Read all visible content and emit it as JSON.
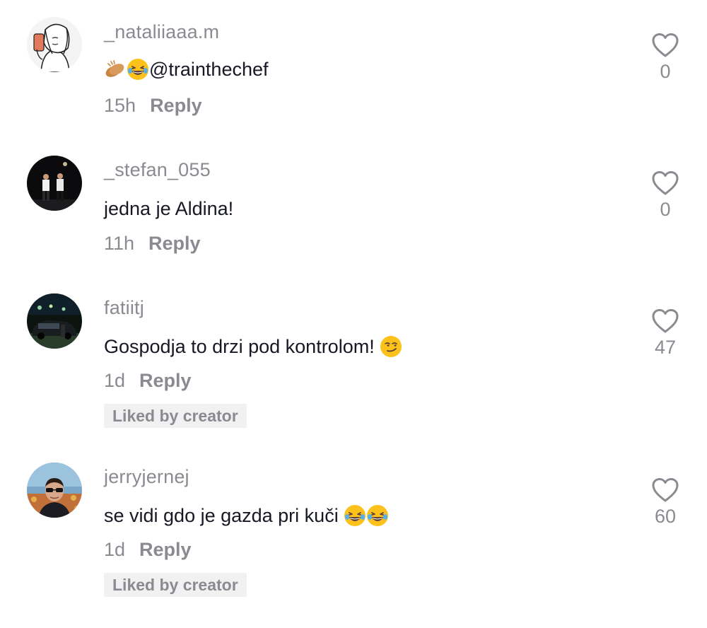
{
  "comments": [
    {
      "username": "_nataliiaaa.m",
      "text": "@trainthechef",
      "emojis": [
        "clapping-hands-emoji",
        "laughing-emoji"
      ],
      "time": "15h",
      "reply_label": "Reply",
      "likes": "0",
      "liked_by_creator": false
    },
    {
      "username": "_stefan_055",
      "text": "jedna je Aldina!",
      "emojis": [],
      "time": "11h",
      "reply_label": "Reply",
      "likes": "0",
      "liked_by_creator": false
    },
    {
      "username": "fatiitj",
      "text": "Gospodja to drzi pod kontrolom! ",
      "emojis": [
        "smirking-face-emoji"
      ],
      "time": "1d",
      "reply_label": "Reply",
      "likes": "47",
      "liked_by_creator": true,
      "badge": "Liked by creator"
    },
    {
      "username": "jerryjernej",
      "text": "se vidi gdo je gazda pri kuči ",
      "emojis": [
        "laughing-emoji",
        "laughing-emoji"
      ],
      "time": "1d",
      "reply_label": "Reply",
      "likes": "60",
      "liked_by_creator": true,
      "badge": "Liked by creator"
    }
  ],
  "icons": {
    "like": "heart-outline-icon"
  },
  "colors": {
    "text_primary": "#161823",
    "text_secondary": "#8a8b91",
    "badge_bg": "#f1f1f2"
  }
}
